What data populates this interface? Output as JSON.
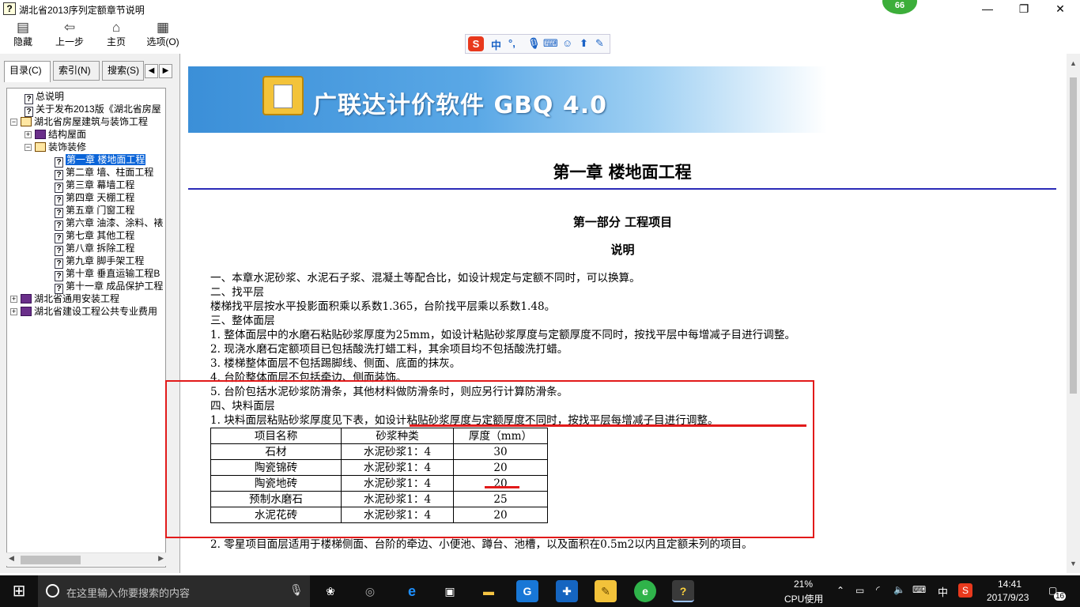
{
  "window": {
    "title": "湖北省2013序列定额章节说明",
    "badge": "66",
    "controls": [
      "minimize",
      "maximize",
      "close"
    ]
  },
  "toolbar": {
    "buttons": [
      {
        "label": "隐藏",
        "icon": "hide-icon"
      },
      {
        "label": "上一步",
        "icon": "back-arrow-icon"
      },
      {
        "label": "主页",
        "icon": "home-icon"
      },
      {
        "label": "选项(O)",
        "icon": "options-icon"
      }
    ],
    "ime": {
      "logo": "S",
      "mode": "中"
    }
  },
  "left_pane": {
    "tabs": [
      "目录(C)",
      "索引(N)",
      "搜索(S)"
    ],
    "tree": [
      {
        "label": "总说明",
        "level": 1,
        "type": "page"
      },
      {
        "label": "关于发布2013版《湖北省房屋",
        "level": 1,
        "type": "page"
      },
      {
        "label": "湖北省房屋建筑与装饰工程",
        "level": 0,
        "type": "book-open",
        "expander": "−"
      },
      {
        "label": "结构屋面",
        "level": 1,
        "type": "book",
        "expander": "+"
      },
      {
        "label": "装饰装修",
        "level": 1,
        "type": "book-open",
        "expander": "−"
      },
      {
        "label": "第一章 楼地面工程",
        "level": 2,
        "type": "page",
        "selected": true
      },
      {
        "label": "第二章 墙、柱面工程",
        "level": 2,
        "type": "page"
      },
      {
        "label": "第三章 幕墙工程",
        "level": 2,
        "type": "page"
      },
      {
        "label": "第四章 天棚工程",
        "level": 2,
        "type": "page"
      },
      {
        "label": "第五章 门窗工程",
        "level": 2,
        "type": "page"
      },
      {
        "label": "第六章 油漆、涂料、裱",
        "level": 2,
        "type": "page"
      },
      {
        "label": "第七章 其他工程",
        "level": 2,
        "type": "page"
      },
      {
        "label": "第八章 拆除工程",
        "level": 2,
        "type": "page"
      },
      {
        "label": "第九章 脚手架工程",
        "level": 2,
        "type": "page"
      },
      {
        "label": "第十章 垂直运输工程B",
        "level": 2,
        "type": "page"
      },
      {
        "label": "第十一章 成品保护工程",
        "level": 2,
        "type": "page"
      },
      {
        "label": "湖北省通用安装工程",
        "level": 0,
        "type": "book",
        "expander": "+"
      },
      {
        "label": "湖北省建设工程公共专业费用",
        "level": 0,
        "type": "book",
        "expander": "+"
      }
    ]
  },
  "content": {
    "banner_title": "广联达计价软件 GBQ 4.0",
    "chapter_title": "第一章  楼地面工程",
    "part_title": "第一部分  工程项目",
    "section_title": "说明",
    "paragraphs": [
      "一、本章水泥砂浆、水泥石子浆、混凝土等配合比，如设计规定与定额不同时，可以换算。",
      "二、找平层",
      "楼梯找平层按水平投影面积乘以系数1.365，台阶找平层乘以系数1.48。",
      "三、整体面层",
      "1. 整体面层中的水磨石粘贴砂浆厚度为25mm，如设计粘贴砂浆厚度与定额厚度不同时，按找平层中每增减子目进行调整。",
      "2. 现浇水磨石定额项目已包括酸洗打蜡工料，其余项目均不包括酸洗打蜡。",
      "3. 楼梯整体面层不包括踢脚线、侧面、底面的抹灰。",
      "4. 台阶整体面层不包括牵边、侧面装饰。",
      "5. 台阶包括水泥砂浆防滑条，其他材料做防滑条时，则应另行计算防滑条。",
      "四、块料面层",
      "1. 块料面层粘贴砂浆厚度见下表，如设计粘贴砂浆厚度与定额厚度不同时，按找平层每增减子目进行调整。"
    ],
    "table": {
      "headers": [
        "项目名称",
        "砂浆种类",
        "厚度（mm）"
      ],
      "rows": [
        [
          "石材",
          "水泥砂浆1：4",
          "30"
        ],
        [
          "陶瓷锦砖",
          "水泥砂浆1：4",
          "20"
        ],
        [
          "陶瓷地砖",
          "水泥砂浆1：4",
          "20"
        ],
        [
          "预制水磨石",
          "水泥砂浆1：4",
          "25"
        ],
        [
          "水泥花砖",
          "水泥砂浆1：4",
          "20"
        ]
      ]
    },
    "after_table": "2. 零星项目面层适用于楼梯侧面、台阶的牵边、小便池、蹲台、池槽，以及面积在0.5m2以内且定额未列的项目。"
  },
  "taskbar": {
    "search_placeholder": "在这里输入你要搜索的内容",
    "cpu_percent": "21%",
    "cpu_label": "CPU使用",
    "ime": "中",
    "time": "14:41",
    "date": "2017/9/23",
    "notifications": "16"
  },
  "colors": {
    "annotation_red": "#e21a1a",
    "heading_rule": "#2b2bb8",
    "selection": "#0a64d8",
    "taskbar": "#101010"
  }
}
